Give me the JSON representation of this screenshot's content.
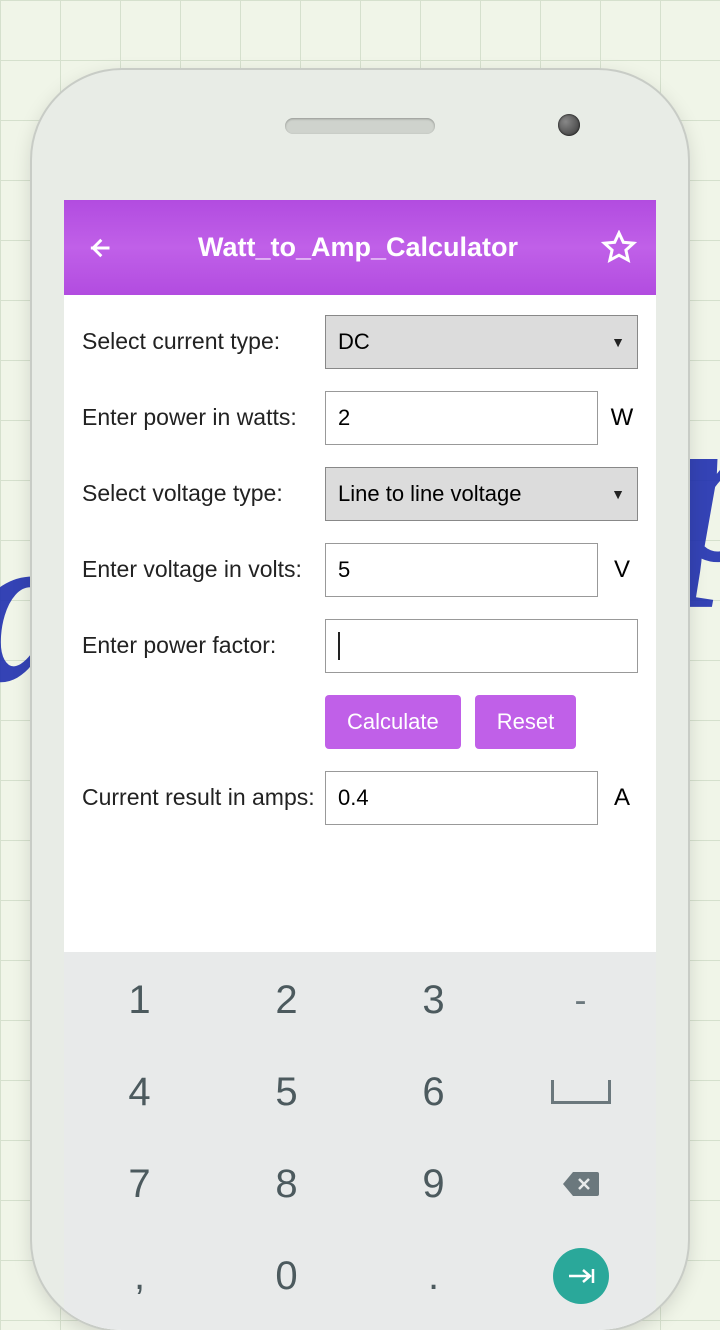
{
  "header": {
    "title": "Watt_to_Amp_Calculator"
  },
  "form": {
    "currentTypeLabel": "Select current type:",
    "currentTypeValue": "DC",
    "powerLabel": "Enter power in watts:",
    "powerValue": "2",
    "powerUnit": "W",
    "voltageTypeLabel": "Select voltage type:",
    "voltageTypeValue": "Line to line voltage",
    "voltageLabel": "Enter voltage in volts:",
    "voltageValue": "5",
    "voltageUnit": "V",
    "pfLabel": "Enter power factor:",
    "pfValue": "",
    "calcBtn": "Calculate",
    "resetBtn": "Reset",
    "resultLabel": "Current result in amps:",
    "resultValue": "0.4",
    "resultUnit": "A"
  },
  "keypad": {
    "r1": [
      "1",
      "2",
      "3",
      "-"
    ],
    "r2": [
      "4",
      "5",
      "6"
    ],
    "r3": [
      "7",
      "8",
      "9"
    ],
    "r4": [
      ",",
      "0",
      "."
    ]
  }
}
